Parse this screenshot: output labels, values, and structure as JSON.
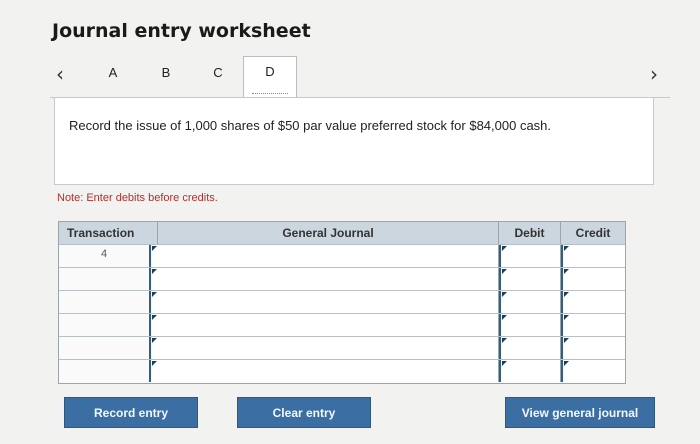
{
  "title": "Journal entry worksheet",
  "tabs": {
    "prev_icon": "chevron-left-icon",
    "next_icon": "chevron-right-icon",
    "items": [
      "A",
      "B",
      "C",
      "D"
    ],
    "active": "D"
  },
  "prompt": "Record the issue of 1,000 shares of $50 par value preferred stock for $84,000 cash.",
  "note": "Note: Enter debits before credits.",
  "table": {
    "columns": [
      "Transaction",
      "General Journal",
      "Debit",
      "Credit"
    ],
    "rows": [
      {
        "transaction": "4",
        "account": "",
        "debit": "",
        "credit": ""
      },
      {
        "transaction": "",
        "account": "",
        "debit": "",
        "credit": ""
      },
      {
        "transaction": "",
        "account": "",
        "debit": "",
        "credit": ""
      },
      {
        "transaction": "",
        "account": "",
        "debit": "",
        "credit": ""
      },
      {
        "transaction": "",
        "account": "",
        "debit": "",
        "credit": ""
      },
      {
        "transaction": "",
        "account": "",
        "debit": "",
        "credit": ""
      }
    ]
  },
  "buttons": {
    "record": "Record entry",
    "clear": "Clear entry",
    "view": "View general journal"
  },
  "colors": {
    "button_bg": "#3b6fa3",
    "header_bg": "#ccd6df",
    "note_text": "#b0302f"
  }
}
